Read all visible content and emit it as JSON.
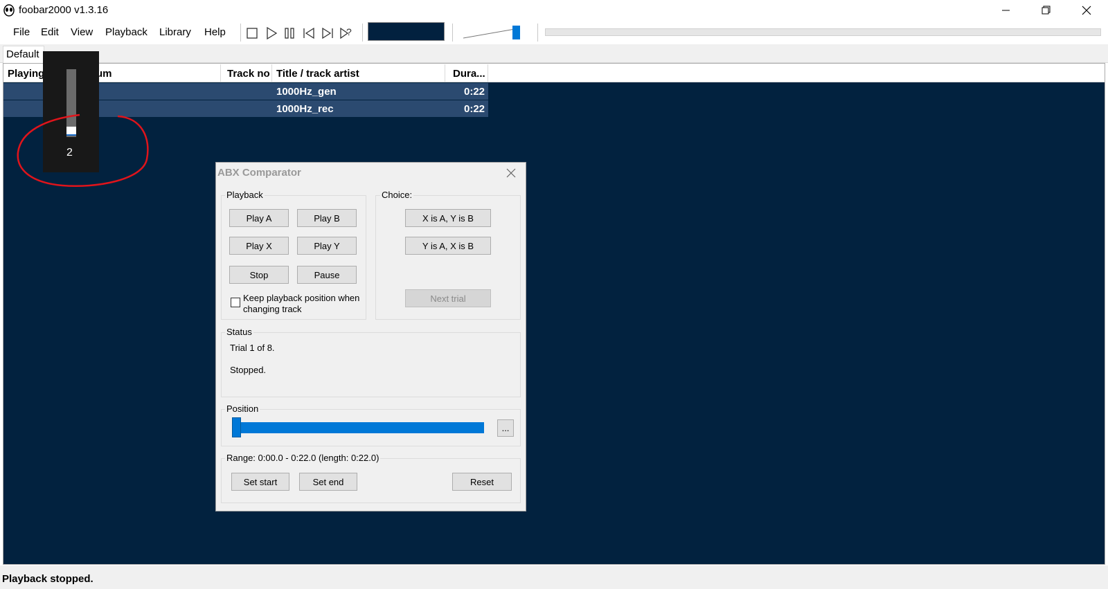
{
  "window": {
    "title": "foobar2000 v1.3.16"
  },
  "menu": {
    "items": [
      "File",
      "Edit",
      "View",
      "Playback",
      "Library",
      "Help"
    ]
  },
  "toolbar": {
    "icons": [
      "stop-icon",
      "play-icon",
      "pause-icon",
      "previous-icon",
      "next-icon",
      "random-icon"
    ],
    "volume_level": 0.92
  },
  "tabs": [
    {
      "label": "Default"
    }
  ],
  "playlist": {
    "columns": [
      "Playing",
      "Artist/album",
      "Track no",
      "Title / track artist",
      "Dura..."
    ],
    "rows": [
      {
        "title": "1000Hz_gen",
        "duration": "0:22"
      },
      {
        "title": "1000Hz_rec",
        "duration": "0:22"
      }
    ]
  },
  "overlay": {
    "value_label": "2"
  },
  "status_bar": {
    "text": "Playback stopped."
  },
  "abx_dialog": {
    "title": "ABX Comparator",
    "playback_group": "Playback",
    "buttons": {
      "play_a": "Play A",
      "play_b": "Play B",
      "play_x": "Play X",
      "play_y": "Play Y",
      "stop": "Stop",
      "pause": "Pause"
    },
    "keep_position_label": "Keep playback position when changing track",
    "choice_group": "Choice:",
    "choice_buttons": {
      "x_is_a": "X is A, Y is B",
      "y_is_a": "Y is A, X is B",
      "next_trial": "Next trial"
    },
    "status_group": "Status",
    "status_lines": [
      "Trial 1 of 8.",
      "Stopped."
    ],
    "position_group": "Position",
    "position_more": "...",
    "position_value": 0.0,
    "range_group": "Range: 0:00.0 - 0:22.0 (length: 0:22.0)",
    "range_buttons": {
      "set_start": "Set start",
      "set_end": "Set end",
      "reset": "Reset"
    }
  },
  "colors": {
    "playlist_bg": "#02223f",
    "selected_row": "#2b4a70",
    "accent": "#0078d7",
    "annotation": "#e0141b"
  }
}
